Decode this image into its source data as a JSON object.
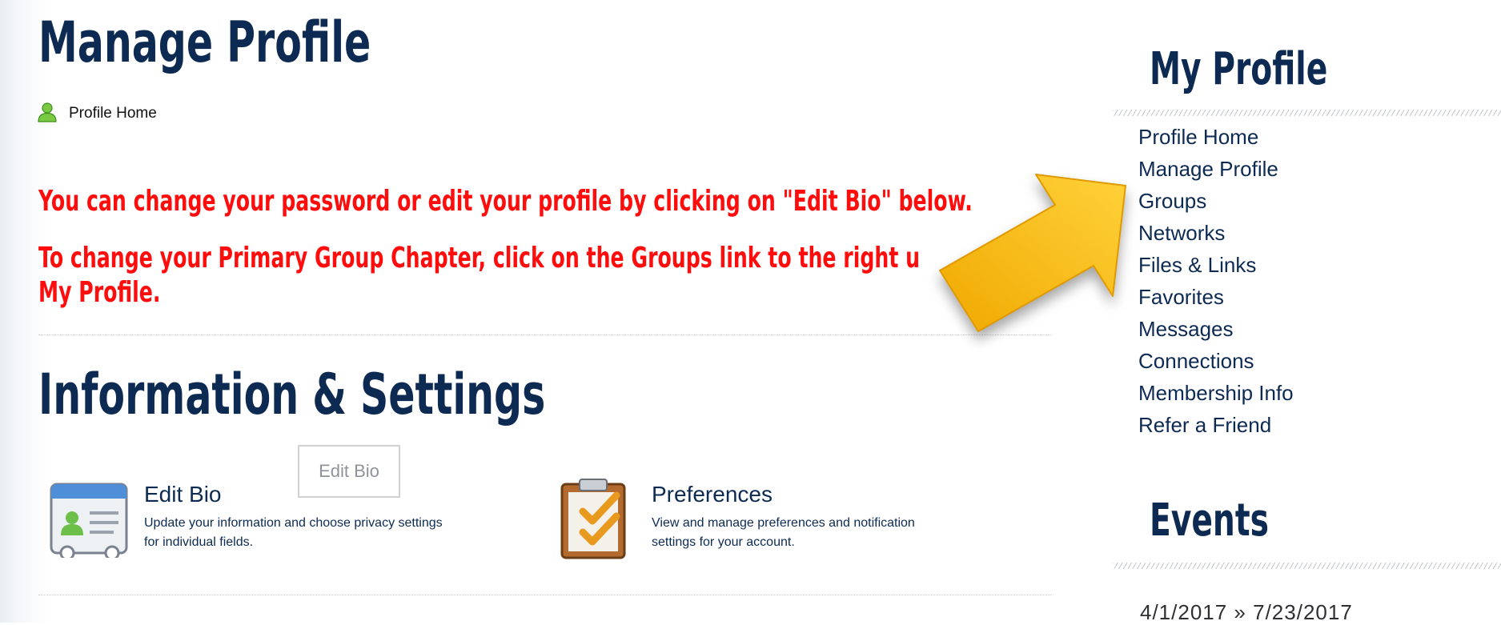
{
  "main": {
    "title": "Manage Profile",
    "breadcrumb": {
      "label": "Profile Home",
      "icon": "user-icon"
    },
    "notices": [
      "You can change your password or edit your profile by clicking on \"Edit Bio\" below.",
      "To change your Primary Group Chapter, click on the Groups link to the right u",
      "My Profile."
    ],
    "notice_color": "#ff0d0d",
    "section_title": "Information & Settings",
    "cards": [
      {
        "title": "Edit Bio",
        "icon": "contact-card-icon",
        "desc_line1": "Update your information and choose privacy settings",
        "desc_line2": "for individual fields."
      },
      {
        "title": "Preferences",
        "icon": "clipboard-check-icon",
        "desc_line1": "View and manage preferences and notification",
        "desc_line2": "settings for your account."
      }
    ],
    "edit_bio_button": "Edit Bio"
  },
  "sidebar": {
    "title": "My Profile",
    "items": [
      "Profile Home",
      "Manage Profile",
      "Groups",
      "Networks",
      "Files & Links",
      "Favorites",
      "Messages",
      "Connections",
      "Membership Info",
      "Refer a Friend"
    ],
    "events_title": "Events",
    "event_date": "4/1/2017 » 7/23/2017"
  },
  "colors": {
    "heading": "#0d2a52",
    "arrow": "#f7b500"
  }
}
